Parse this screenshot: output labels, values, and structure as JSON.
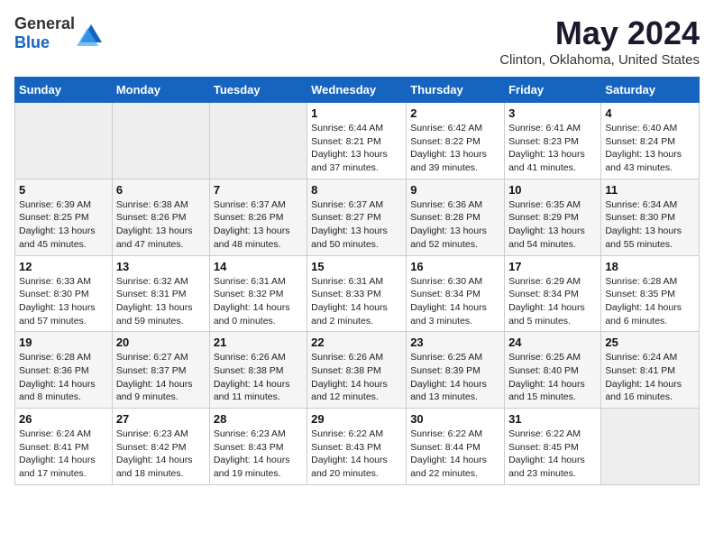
{
  "header": {
    "logo_general": "General",
    "logo_blue": "Blue",
    "main_title": "May 2024",
    "subtitle": "Clinton, Oklahoma, United States"
  },
  "days_of_week": [
    "Sunday",
    "Monday",
    "Tuesday",
    "Wednesday",
    "Thursday",
    "Friday",
    "Saturday"
  ],
  "weeks": [
    [
      {
        "day": "",
        "info": ""
      },
      {
        "day": "",
        "info": ""
      },
      {
        "day": "",
        "info": ""
      },
      {
        "day": "1",
        "info": "Sunrise: 6:44 AM\nSunset: 8:21 PM\nDaylight: 13 hours and 37 minutes."
      },
      {
        "day": "2",
        "info": "Sunrise: 6:42 AM\nSunset: 8:22 PM\nDaylight: 13 hours and 39 minutes."
      },
      {
        "day": "3",
        "info": "Sunrise: 6:41 AM\nSunset: 8:23 PM\nDaylight: 13 hours and 41 minutes."
      },
      {
        "day": "4",
        "info": "Sunrise: 6:40 AM\nSunset: 8:24 PM\nDaylight: 13 hours and 43 minutes."
      }
    ],
    [
      {
        "day": "5",
        "info": "Sunrise: 6:39 AM\nSunset: 8:25 PM\nDaylight: 13 hours and 45 minutes."
      },
      {
        "day": "6",
        "info": "Sunrise: 6:38 AM\nSunset: 8:26 PM\nDaylight: 13 hours and 47 minutes."
      },
      {
        "day": "7",
        "info": "Sunrise: 6:37 AM\nSunset: 8:26 PM\nDaylight: 13 hours and 48 minutes."
      },
      {
        "day": "8",
        "info": "Sunrise: 6:37 AM\nSunset: 8:27 PM\nDaylight: 13 hours and 50 minutes."
      },
      {
        "day": "9",
        "info": "Sunrise: 6:36 AM\nSunset: 8:28 PM\nDaylight: 13 hours and 52 minutes."
      },
      {
        "day": "10",
        "info": "Sunrise: 6:35 AM\nSunset: 8:29 PM\nDaylight: 13 hours and 54 minutes."
      },
      {
        "day": "11",
        "info": "Sunrise: 6:34 AM\nSunset: 8:30 PM\nDaylight: 13 hours and 55 minutes."
      }
    ],
    [
      {
        "day": "12",
        "info": "Sunrise: 6:33 AM\nSunset: 8:30 PM\nDaylight: 13 hours and 57 minutes."
      },
      {
        "day": "13",
        "info": "Sunrise: 6:32 AM\nSunset: 8:31 PM\nDaylight: 13 hours and 59 minutes."
      },
      {
        "day": "14",
        "info": "Sunrise: 6:31 AM\nSunset: 8:32 PM\nDaylight: 14 hours and 0 minutes."
      },
      {
        "day": "15",
        "info": "Sunrise: 6:31 AM\nSunset: 8:33 PM\nDaylight: 14 hours and 2 minutes."
      },
      {
        "day": "16",
        "info": "Sunrise: 6:30 AM\nSunset: 8:34 PM\nDaylight: 14 hours and 3 minutes."
      },
      {
        "day": "17",
        "info": "Sunrise: 6:29 AM\nSunset: 8:34 PM\nDaylight: 14 hours and 5 minutes."
      },
      {
        "day": "18",
        "info": "Sunrise: 6:28 AM\nSunset: 8:35 PM\nDaylight: 14 hours and 6 minutes."
      }
    ],
    [
      {
        "day": "19",
        "info": "Sunrise: 6:28 AM\nSunset: 8:36 PM\nDaylight: 14 hours and 8 minutes."
      },
      {
        "day": "20",
        "info": "Sunrise: 6:27 AM\nSunset: 8:37 PM\nDaylight: 14 hours and 9 minutes."
      },
      {
        "day": "21",
        "info": "Sunrise: 6:26 AM\nSunset: 8:38 PM\nDaylight: 14 hours and 11 minutes."
      },
      {
        "day": "22",
        "info": "Sunrise: 6:26 AM\nSunset: 8:38 PM\nDaylight: 14 hours and 12 minutes."
      },
      {
        "day": "23",
        "info": "Sunrise: 6:25 AM\nSunset: 8:39 PM\nDaylight: 14 hours and 13 minutes."
      },
      {
        "day": "24",
        "info": "Sunrise: 6:25 AM\nSunset: 8:40 PM\nDaylight: 14 hours and 15 minutes."
      },
      {
        "day": "25",
        "info": "Sunrise: 6:24 AM\nSunset: 8:41 PM\nDaylight: 14 hours and 16 minutes."
      }
    ],
    [
      {
        "day": "26",
        "info": "Sunrise: 6:24 AM\nSunset: 8:41 PM\nDaylight: 14 hours and 17 minutes."
      },
      {
        "day": "27",
        "info": "Sunrise: 6:23 AM\nSunset: 8:42 PM\nDaylight: 14 hours and 18 minutes."
      },
      {
        "day": "28",
        "info": "Sunrise: 6:23 AM\nSunset: 8:43 PM\nDaylight: 14 hours and 19 minutes."
      },
      {
        "day": "29",
        "info": "Sunrise: 6:22 AM\nSunset: 8:43 PM\nDaylight: 14 hours and 20 minutes."
      },
      {
        "day": "30",
        "info": "Sunrise: 6:22 AM\nSunset: 8:44 PM\nDaylight: 14 hours and 22 minutes."
      },
      {
        "day": "31",
        "info": "Sunrise: 6:22 AM\nSunset: 8:45 PM\nDaylight: 14 hours and 23 minutes."
      },
      {
        "day": "",
        "info": ""
      }
    ]
  ]
}
